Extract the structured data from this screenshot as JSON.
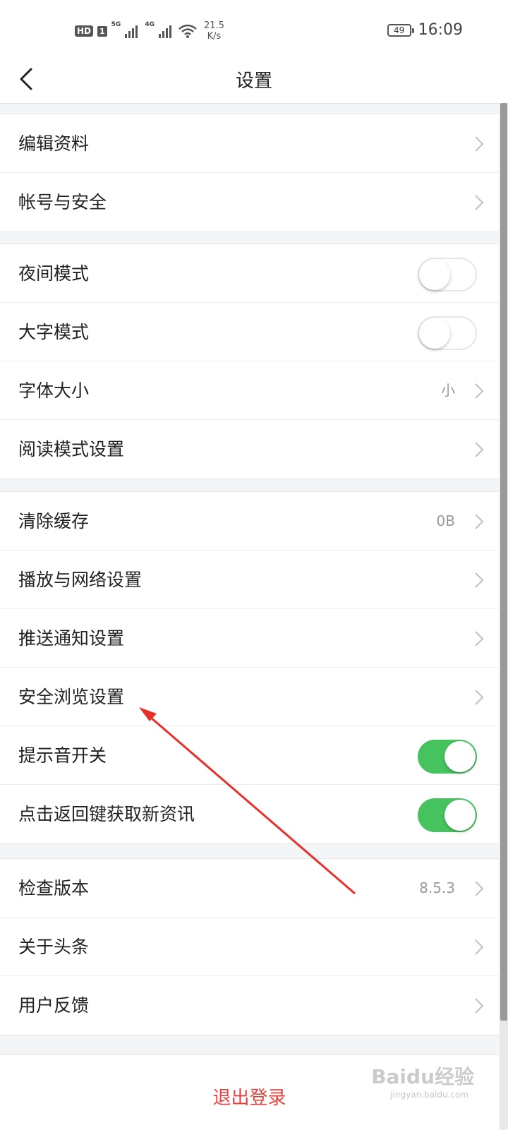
{
  "status_bar": {
    "hd": "HD",
    "sim": "1",
    "net1": "5G",
    "net2": "4G",
    "speed_value": "21.5",
    "speed_unit": "K/s",
    "battery": "49",
    "time": "16:09"
  },
  "header": {
    "title": "设置",
    "back_icon": "chevron-left-icon"
  },
  "groups": [
    {
      "items": [
        {
          "label": "编辑资料",
          "control": "chevron"
        },
        {
          "label": "帐号与安全",
          "control": "chevron"
        }
      ]
    },
    {
      "items": [
        {
          "label": "夜间模式",
          "control": "toggle",
          "on": false
        },
        {
          "label": "大字模式",
          "control": "toggle",
          "on": false
        },
        {
          "label": "字体大小",
          "control": "chevron",
          "value": "小"
        },
        {
          "label": "阅读模式设置",
          "control": "chevron"
        }
      ]
    },
    {
      "items": [
        {
          "label": "清除缓存",
          "control": "chevron",
          "value": "0B"
        },
        {
          "label": "播放与网络设置",
          "control": "chevron"
        },
        {
          "label": "推送通知设置",
          "control": "chevron"
        },
        {
          "label": "安全浏览设置",
          "control": "chevron"
        },
        {
          "label": "提示音开关",
          "control": "toggle",
          "on": true
        },
        {
          "label": "点击返回键获取新资讯",
          "control": "toggle",
          "on": true
        }
      ]
    },
    {
      "items": [
        {
          "label": "检查版本",
          "control": "chevron",
          "value": "8.5.3"
        },
        {
          "label": "关于头条",
          "control": "chevron"
        },
        {
          "label": "用户反馈",
          "control": "chevron"
        }
      ]
    }
  ],
  "logout": {
    "label": "退出登录"
  },
  "watermark": {
    "text": "Baidu经验",
    "sub": "jingyan.baidu.com"
  },
  "colors": {
    "toggle_on": "#46c35f",
    "logout": "#e8403a",
    "annotation_arrow": "#e8302a"
  }
}
